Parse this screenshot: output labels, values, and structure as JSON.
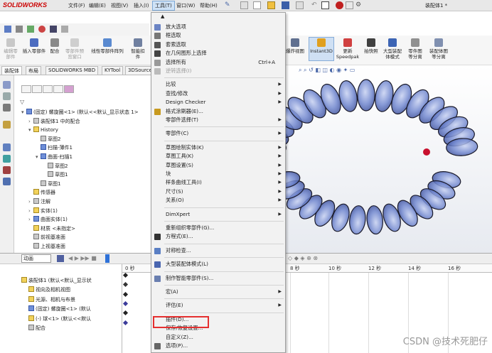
{
  "app": {
    "logo": "SOLIDWORKS",
    "document_title": "装配体1 *",
    "menubar": [
      "文件(F)",
      "编辑(E)",
      "视图(V)",
      "插入(I)",
      "工具(T)",
      "窗口(W)",
      "帮助(H)"
    ]
  },
  "commands": [
    {
      "label": "编辑零\n部件",
      "disabled": true
    },
    {
      "label": "插入零部件",
      "disabled": false
    },
    {
      "label": "配合",
      "disabled": false
    },
    {
      "label": "零部件预\n览窗口",
      "disabled": true
    },
    {
      "label": "线性零部件阵列",
      "disabled": false
    },
    {
      "label": "智能扣\n件",
      "disabled": false
    },
    {
      "label": "爆炸视图",
      "disabled": false
    },
    {
      "label": "Instant3D",
      "disabled": false
    },
    {
      "label": "更新\nSpeedpak",
      "disabled": false
    },
    {
      "label": "拍快照",
      "disabled": false
    },
    {
      "label": "大型装配\n体模式",
      "disabled": false
    },
    {
      "label": "零件图\n等分离",
      "disabled": false
    },
    {
      "label": "装配体图\n等分离",
      "disabled": false
    }
  ],
  "tabs": [
    "装配体",
    "布局",
    "SOLIDWORKS MBD",
    "KYTool",
    "3DSource"
  ],
  "feature_tree": [
    {
      "label": "(固定) 螺旋圈<1> (默认<<默认_显示状态 1>",
      "indent": 0,
      "caret": "▾"
    },
    {
      "label": "装配体1 中的配合",
      "indent": 1,
      "caret": "›"
    },
    {
      "label": "History",
      "indent": 1,
      "caret": "▾"
    },
    {
      "label": "草图2",
      "indent": 2,
      "caret": ""
    },
    {
      "label": "扫描-薄件1",
      "indent": 2,
      "caret": ""
    },
    {
      "label": "曲面-扫描1",
      "indent": 2,
      "caret": "▾"
    },
    {
      "label": "草图2",
      "indent": 3,
      "caret": ""
    },
    {
      "label": "草图1",
      "indent": 3,
      "caret": ""
    },
    {
      "label": "草图1",
      "indent": 2,
      "caret": ""
    },
    {
      "label": "传感器",
      "indent": 1,
      "caret": ""
    },
    {
      "label": "注解",
      "indent": 1,
      "caret": "›"
    },
    {
      "label": "实体(1)",
      "indent": 1,
      "caret": "›"
    },
    {
      "label": "曲面实体(1)",
      "indent": 1,
      "caret": "›"
    },
    {
      "label": "材质 <未指定>",
      "indent": 1,
      "caret": ""
    },
    {
      "label": "前视基准面",
      "indent": 1,
      "caret": ""
    },
    {
      "label": "上视基准面",
      "indent": 1,
      "caret": ""
    }
  ],
  "animation": {
    "mode": "动画",
    "tree": [
      {
        "label": "装配体1 (默认<默认_显示状",
        "indent": 0
      },
      {
        "label": "视向及相机视图",
        "indent": 1
      },
      {
        "label": "光源、相机与布景",
        "indent": 1
      },
      {
        "label": "(固定) 螺旋圈<1> (默认",
        "indent": 1
      },
      {
        "label": "(-) 球<1> (默认<<默认",
        "indent": 1
      },
      {
        "label": "配合",
        "indent": 1
      }
    ],
    "ruler": [
      "0 秒",
      "8 秒",
      "10 秒",
      "12 秒",
      "14 秒",
      "16 秒"
    ]
  },
  "tools_menu": [
    {
      "label": "放大选项",
      "icon": "zoom-icon",
      "shortcut": "",
      "arrow": false,
      "disabled": false,
      "sep_before": false
    },
    {
      "label": "框选取",
      "icon": "box-select-icon",
      "shortcut": "",
      "arrow": false,
      "disabled": false,
      "sep_before": false
    },
    {
      "label": "套索选取",
      "icon": "lasso-icon",
      "shortcut": "",
      "arrow": false,
      "disabled": false,
      "sep_before": false
    },
    {
      "label": "在几何图形上选择",
      "icon": "geometry-select-icon",
      "shortcut": "",
      "arrow": false,
      "disabled": false,
      "sep_before": false
    },
    {
      "label": "选择所有",
      "icon": "select-all-icon",
      "shortcut": "Ctrl+A",
      "arrow": false,
      "disabled": false,
      "sep_before": false
    },
    {
      "label": "逆转选择(I)",
      "icon": "invert-icon",
      "shortcut": "",
      "arrow": false,
      "disabled": true,
      "sep_before": false
    },
    {
      "label": "比较",
      "icon": "",
      "shortcut": "",
      "arrow": true,
      "disabled": false,
      "sep_before": true
    },
    {
      "label": "查找/修改",
      "icon": "",
      "shortcut": "",
      "arrow": true,
      "disabled": false,
      "sep_before": false
    },
    {
      "label": "Design Checker",
      "icon": "",
      "shortcut": "",
      "arrow": true,
      "disabled": false,
      "sep_before": false
    },
    {
      "label": "格式涂刷器(E)...",
      "icon": "format-painter-icon",
      "shortcut": "",
      "arrow": false,
      "disabled": false,
      "sep_before": false
    },
    {
      "label": "零部件选择(T)",
      "icon": "",
      "shortcut": "",
      "arrow": true,
      "disabled": false,
      "sep_before": false
    },
    {
      "label": "零部件(C)",
      "icon": "",
      "shortcut": "",
      "arrow": true,
      "disabled": false,
      "sep_before": true
    },
    {
      "label": "草图绘制实体(K)",
      "icon": "",
      "shortcut": "",
      "arrow": true,
      "disabled": false,
      "sep_before": true
    },
    {
      "label": "草图工具(K)",
      "icon": "",
      "shortcut": "",
      "arrow": true,
      "disabled": false,
      "sep_before": false
    },
    {
      "label": "草图设置(S)",
      "icon": "",
      "shortcut": "",
      "arrow": true,
      "disabled": false,
      "sep_before": false
    },
    {
      "label": "块",
      "icon": "",
      "shortcut": "",
      "arrow": true,
      "disabled": false,
      "sep_before": false
    },
    {
      "label": "样条曲线工具(I)",
      "icon": "",
      "shortcut": "",
      "arrow": true,
      "disabled": false,
      "sep_before": false
    },
    {
      "label": "尺寸(S)",
      "icon": "",
      "shortcut": "",
      "arrow": true,
      "disabled": false,
      "sep_before": false
    },
    {
      "label": "关系(O)",
      "icon": "",
      "shortcut": "",
      "arrow": true,
      "disabled": false,
      "sep_before": false
    },
    {
      "label": "DimXpert",
      "icon": "",
      "shortcut": "",
      "arrow": true,
      "disabled": false,
      "sep_before": true
    },
    {
      "label": "重新组织零部件(G)...",
      "icon": "",
      "shortcut": "",
      "arrow": false,
      "disabled": false,
      "sep_before": true
    },
    {
      "label": "方程式(E)...",
      "icon": "sigma-icon",
      "shortcut": "",
      "arrow": false,
      "disabled": false,
      "sep_before": false
    },
    {
      "label": "对称检查...",
      "icon": "symmetry-icon",
      "shortcut": "",
      "arrow": false,
      "disabled": false,
      "sep_before": true
    },
    {
      "label": "大型装配体模式(L)",
      "icon": "large-assembly-icon",
      "shortcut": "",
      "arrow": false,
      "disabled": false,
      "sep_before": true
    },
    {
      "label": "制作智能零部件(S)...",
      "icon": "smart-component-icon",
      "shortcut": "",
      "arrow": false,
      "disabled": false,
      "sep_before": true
    },
    {
      "label": "宏(A)",
      "icon": "",
      "shortcut": "",
      "arrow": true,
      "disabled": false,
      "sep_before": true
    },
    {
      "label": "评估(E)",
      "icon": "",
      "shortcut": "",
      "arrow": true,
      "disabled": false,
      "sep_before": true
    },
    {
      "label": "插件(D)...",
      "icon": "",
      "shortcut": "",
      "arrow": false,
      "disabled": false,
      "sep_before": true
    },
    {
      "label": "保存/恢复设置...",
      "icon": "",
      "shortcut": "",
      "arrow": false,
      "disabled": false,
      "sep_before": false
    },
    {
      "label": "自定义(Z)...",
      "icon": "",
      "shortcut": "",
      "arrow": false,
      "disabled": false,
      "sep_before": false
    },
    {
      "label": "选项(P)...",
      "icon": "gear-icon",
      "shortcut": "",
      "arrow": false,
      "disabled": false,
      "sep_before": false
    }
  ],
  "watermark": "CSDN @技术死肥仔",
  "colors": {
    "accent": "#c00000",
    "highlight": "#e53030",
    "coil": "#5a72c8"
  }
}
